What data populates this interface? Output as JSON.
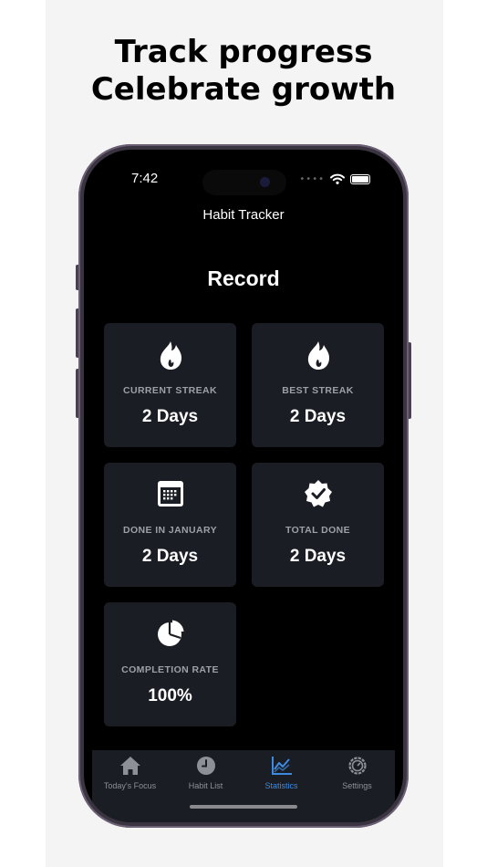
{
  "headline": {
    "line1": "Track progress",
    "line2": "Celebrate growth"
  },
  "status_bar": {
    "time": "7:42",
    "icons": [
      "wifi-icon",
      "battery-icon"
    ]
  },
  "app": {
    "title": "Habit Tracker",
    "section_title": "Record"
  },
  "stats": [
    {
      "icon": "flame-icon",
      "label": "CURRENT STREAK",
      "value": "2 Days"
    },
    {
      "icon": "flame-icon",
      "label": "BEST STREAK",
      "value": "2 Days"
    },
    {
      "icon": "calendar-icon",
      "label": "DONE IN JANUARY",
      "value": "2 Days"
    },
    {
      "icon": "verified-badge-icon",
      "label": "TOTAL DONE",
      "value": "2 Days"
    },
    {
      "icon": "pie-chart-icon",
      "label": "COMPLETION RATE",
      "value": "100%"
    }
  ],
  "tabbar": {
    "active": "Statistics",
    "tabs": [
      {
        "icon": "house-icon",
        "label": "Today's Focus"
      },
      {
        "icon": "clock-icon",
        "label": "Habit List"
      },
      {
        "icon": "chart-icon",
        "label": "Statistics"
      },
      {
        "icon": "settings-gear-icon",
        "label": "Settings"
      }
    ]
  },
  "colors": {
    "accent": "#3d8be0",
    "card_bg": "#1b1d24",
    "screen_bg": "#000000",
    "label_gray": "#9da0a8"
  }
}
